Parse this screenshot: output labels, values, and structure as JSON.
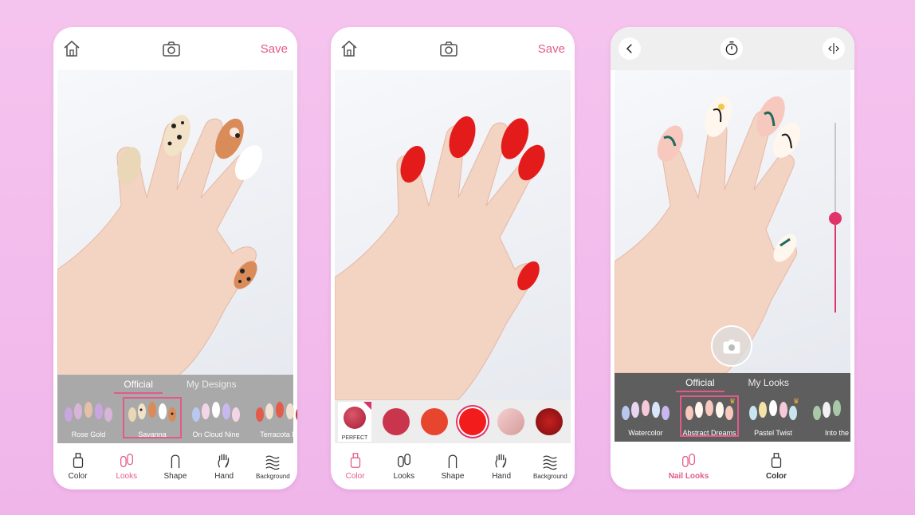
{
  "colors": {
    "accent": "#e25a8c",
    "active_pink": "#e0336a"
  },
  "phone1": {
    "save_label": "Save",
    "tabs": [
      "Official",
      "My Designs"
    ],
    "looks": [
      {
        "name": "Rose Gold"
      },
      {
        "name": "Savanna"
      },
      {
        "name": "On Cloud Nine"
      },
      {
        "name": "Terracota Mi"
      }
    ],
    "nav": [
      "Color",
      "Looks",
      "Shape",
      "Hand",
      "Background"
    ]
  },
  "phone2": {
    "save_label": "Save",
    "perfect_label": "PERFECT",
    "swatches": [
      "#c9354d",
      "#e8452f",
      "#f21c1c",
      "#e8b1b1",
      "#a51616",
      "#8c3d1c"
    ],
    "nav": [
      "Color",
      "Looks",
      "Shape",
      "Hand",
      "Background"
    ]
  },
  "phone3": {
    "tabs": [
      "Official",
      "My Looks"
    ],
    "looks": [
      {
        "name": "Watercolor"
      },
      {
        "name": "Abstract Dreams"
      },
      {
        "name": "Pastel Twist"
      },
      {
        "name": "Into the"
      }
    ],
    "slider_level": 0.5,
    "nav": [
      "Nail Looks",
      "Color"
    ]
  }
}
